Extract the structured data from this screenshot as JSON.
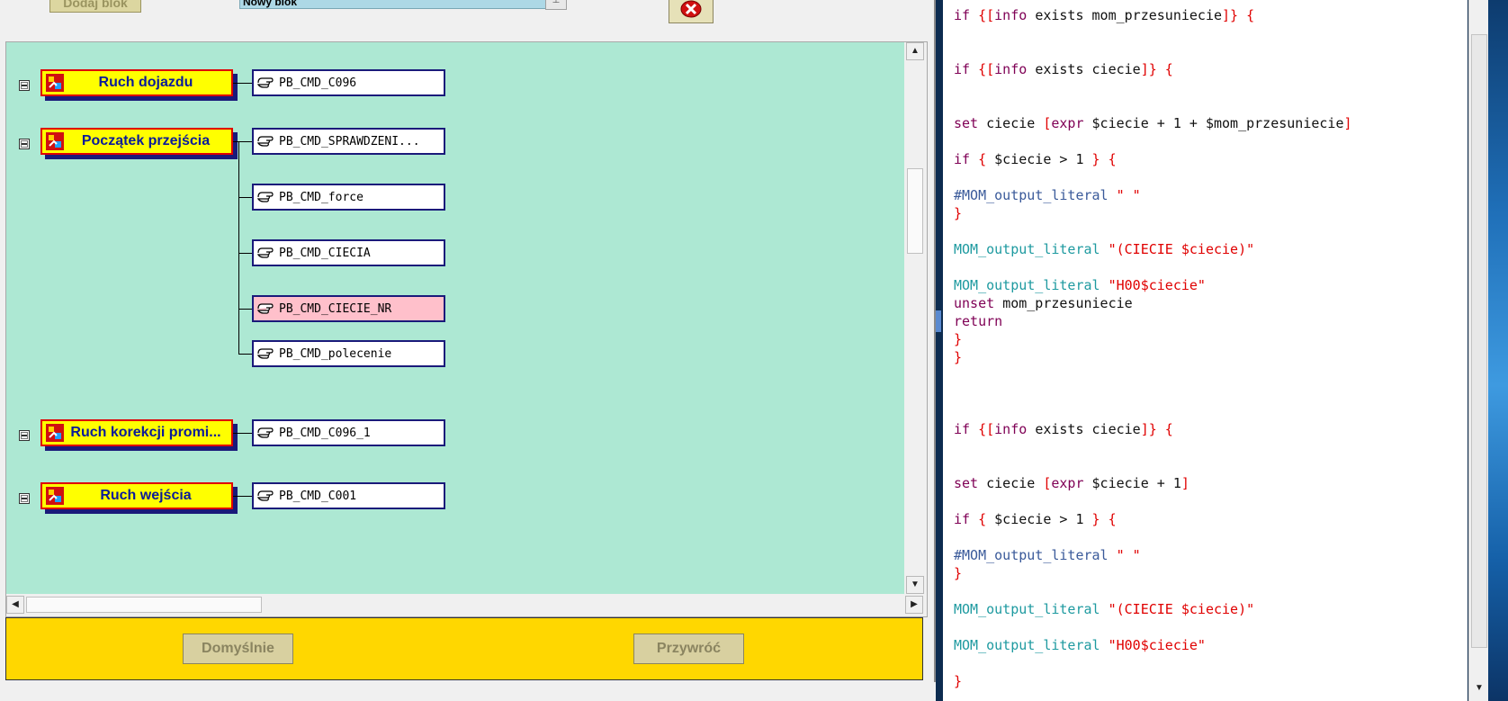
{
  "dialog": {
    "add_block_label": "Dodaj blok",
    "block_name_value": "Nowy blok",
    "delete_icon": "delete-x-icon"
  },
  "tree": {
    "blocks": [
      {
        "label": "Ruch dojazdu",
        "commands": [
          "PB_CMD_C096"
        ]
      },
      {
        "label": "Początek przejścia",
        "commands": [
          "PB_CMD_SPRAWDZENI...",
          "PB_CMD_force",
          "PB_CMD_CIECIA",
          "PB_CMD_CIECIE_NR",
          "PB_CMD_polecenie"
        ]
      },
      {
        "label": "Ruch korekcji promi...",
        "commands": [
          "PB_CMD_C096_1"
        ]
      },
      {
        "label": "Ruch wejścia",
        "commands": [
          "PB_CMD_C001"
        ]
      }
    ],
    "selected_command": "PB_CMD_CIECIE_NR",
    "block_icon": "event-block-icon",
    "command_icon": "hand-pointer-icon"
  },
  "buttons": {
    "default_label": "Domyślnie",
    "restore_label": "Przywróć"
  },
  "colors": {
    "canvas_bg": "#ade8d3",
    "block_fill": "#ffff00",
    "block_border": "#e00000",
    "block_text": "#0a1a9a",
    "selected_cmd": "#ffc0cb",
    "bottom_panel": "#ffd700"
  },
  "code": [
    "if {[info exists mom_przesuniecie]} {",
    "if {[info exists ciecie]} {",
    "set ciecie [expr $ciecie + 1 + $mom_przesuniecie]",
    "if { $ciecie > 1 } {",
    "#MOM_output_literal \" \"",
    "}",
    "MOM_output_literal \"(CIECIE $ciecie)\"",
    "MOM_output_literal \"H00$ciecie\"",
    "unset mom_przesuniecie",
    "return",
    "}",
    "}",
    "if {[info exists ciecie]} {",
    "set ciecie [expr $ciecie + 1]",
    "if { $ciecie > 1 } {",
    "#MOM_output_literal \" \"",
    "}",
    "MOM_output_literal \"(CIECIE $ciecie)\"",
    "MOM_output_literal \"H00$ciecie\"",
    "}"
  ]
}
